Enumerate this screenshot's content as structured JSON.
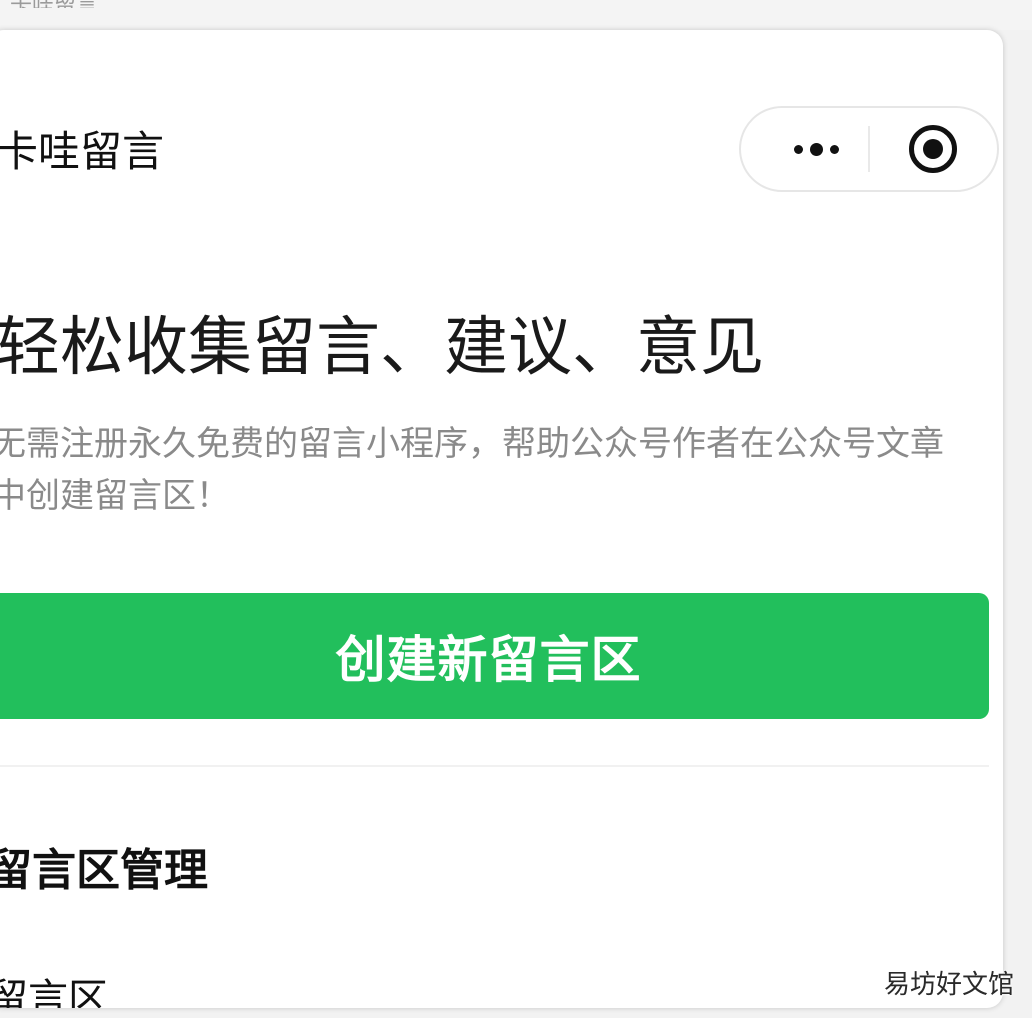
{
  "header": {
    "app_title": "卡哇留言",
    "top_fragment": "卡哇留言"
  },
  "capsule": {
    "more_icon": "more-dots-icon",
    "close_icon": "target-close-icon"
  },
  "hero": {
    "headline": "轻松收集留言、建议、意见",
    "description_line1": "无需注册永久免费的留言小程序，帮助公众号作者在公众号文章",
    "description_line2": "中创建留言区！"
  },
  "cta": {
    "label": "创建新留言区",
    "color": "#22bf5c"
  },
  "management": {
    "title": "留言区管理",
    "items": [
      {
        "label": "留言区"
      }
    ]
  },
  "watermark": "易坊好文馆"
}
